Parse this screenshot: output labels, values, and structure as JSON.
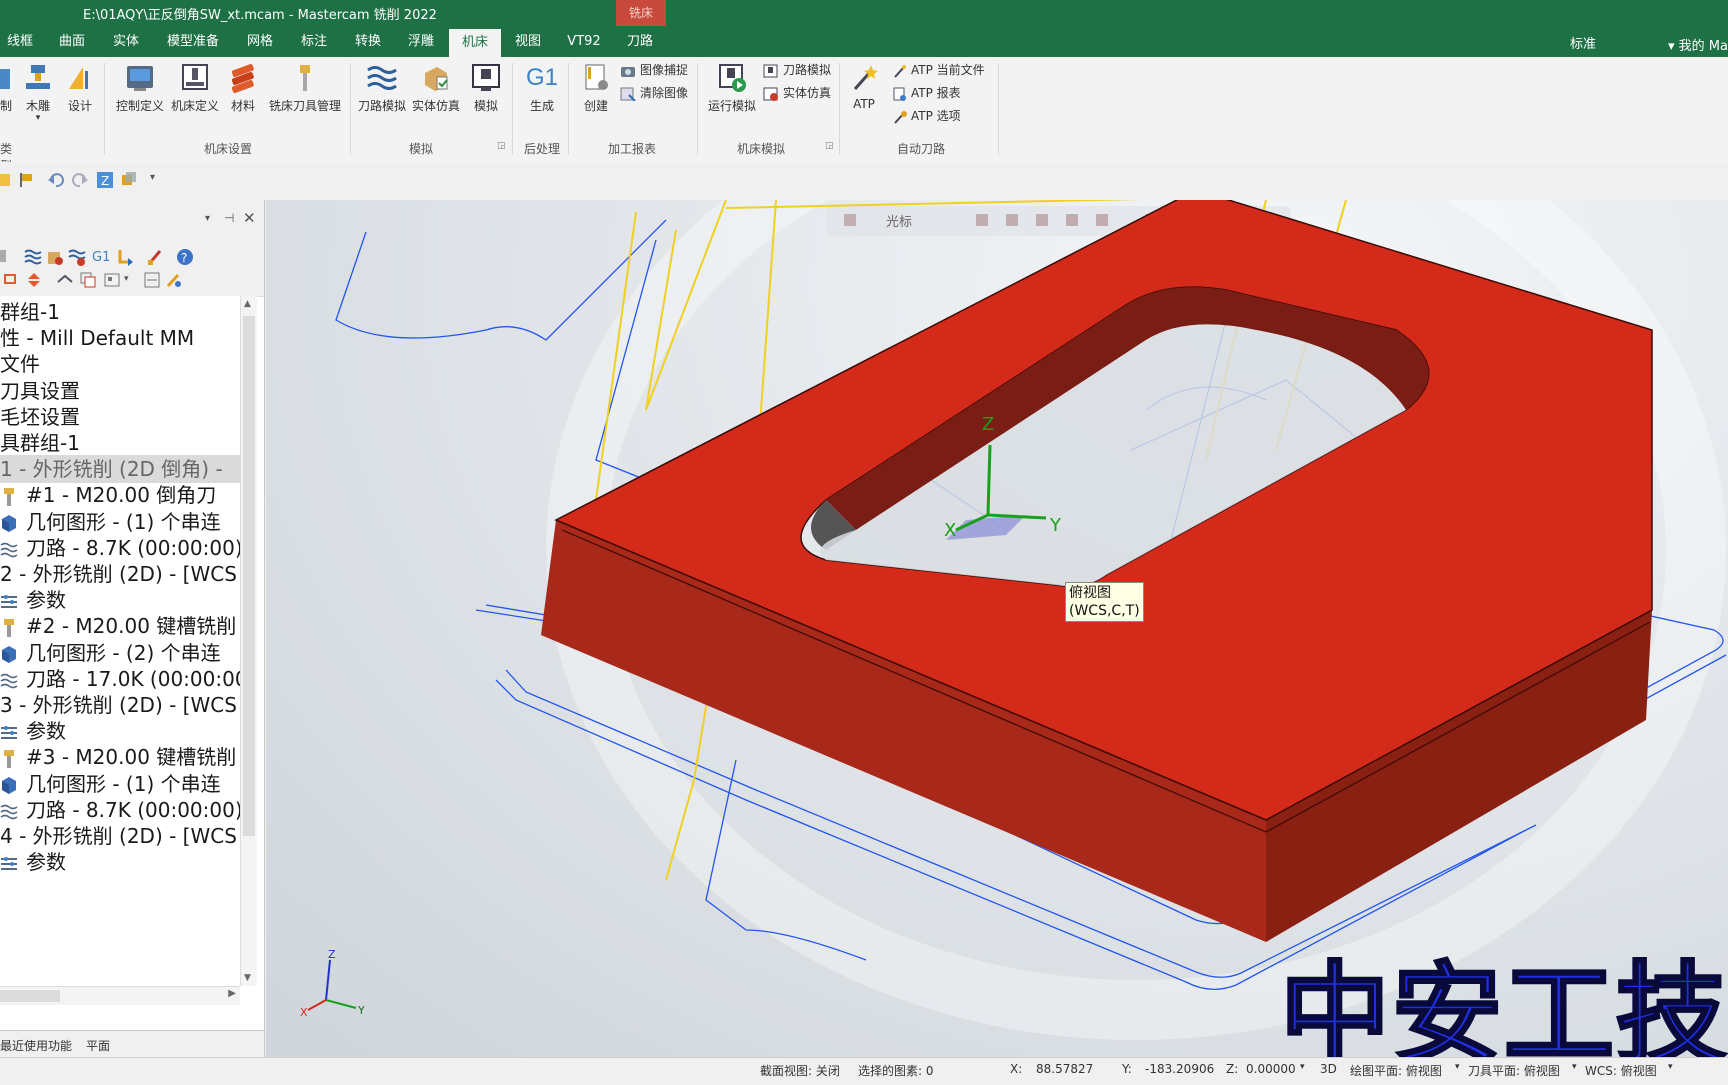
{
  "window": {
    "title": "E:\\01AQY\\正反倒角SW_xt.mcam - Mastercam 铣削 2022",
    "context_tab": "铣床"
  },
  "ribbon_tabs": [
    "线框",
    "曲面",
    "实体",
    "模型准备",
    "网格",
    "标注",
    "转换",
    "浮雕",
    "机床",
    "视图",
    "VT92",
    "刀路"
  ],
  "active_tab": "机床",
  "right": {
    "workspace": "标准",
    "account": "我的 Ma"
  },
  "ribbon": {
    "group_type": {
      "label": "类型",
      "btn1": "制",
      "btn2": "木雕",
      "btn3": "设计"
    },
    "group_machine": {
      "label": "机床设置",
      "btn1": "控制定义",
      "btn2": "机床定义",
      "btn3": "材料",
      "btn4": "铣床刀具管理"
    },
    "group_sim": {
      "label": "模拟",
      "btn1": "刀路模拟",
      "btn2": "实体仿真",
      "btn3": "模拟"
    },
    "group_post": {
      "label": "后处理",
      "btn1": "生成",
      "btn1_icon_text": "G1"
    },
    "group_report": {
      "label": "加工报表",
      "btn1": "创建",
      "small1": "图像捕捉",
      "small2": "清除图像"
    },
    "group_msim": {
      "label": "机床模拟",
      "btn1": "运行模拟",
      "small1": "刀路模拟",
      "small2": "实体仿真"
    },
    "group_atp": {
      "label": "自动刀路",
      "btn1": "ATP",
      "small1": "ATP 当前文件",
      "small2": "ATP 报表",
      "small3": "ATP 选项"
    }
  },
  "tree": [
    {
      "text": "群组-1",
      "indent": 0,
      "icon": "none"
    },
    {
      "text": "性 - Mill Default MM",
      "indent": 0,
      "icon": "none"
    },
    {
      "text": "文件",
      "indent": 0,
      "icon": "none"
    },
    {
      "text": "刀具设置",
      "indent": 0,
      "icon": "none"
    },
    {
      "text": "毛坯设置",
      "indent": 0,
      "icon": "none"
    },
    {
      "text": "具群组-1",
      "indent": 0,
      "icon": "none"
    },
    {
      "text": "1 - 外形铣削 (2D 倒角) -",
      "indent": 0,
      "icon": "none",
      "selected": true
    },
    {
      "text": "#1 - M20.00 倒角刀",
      "indent": 1,
      "icon": "tool"
    },
    {
      "text": "几何图形 - (1) 个串连",
      "indent": 1,
      "icon": "geometry"
    },
    {
      "text": "刀路 - 8.7K (00:00:00)",
      "indent": 1,
      "icon": "toolpath"
    },
    {
      "text": "2 - 外形铣削 (2D) - [WCS",
      "indent": 0,
      "icon": "none"
    },
    {
      "text": "参数",
      "indent": 1,
      "icon": "params"
    },
    {
      "text": "#2 - M20.00 键槽铣削",
      "indent": 1,
      "icon": "tool"
    },
    {
      "text": "几何图形 - (2) 个串连",
      "indent": 1,
      "icon": "geometry"
    },
    {
      "text": "刀路 - 17.0K (00:00:00",
      "indent": 1,
      "icon": "toolpath"
    },
    {
      "text": "3 - 外形铣削 (2D) - [WCS",
      "indent": 0,
      "icon": "none"
    },
    {
      "text": "参数",
      "indent": 1,
      "icon": "params"
    },
    {
      "text": "#3 - M20.00 键槽铣削",
      "indent": 1,
      "icon": "tool"
    },
    {
      "text": "几何图形 - (1) 个串连",
      "indent": 1,
      "icon": "geometry"
    },
    {
      "text": "刀路 - 8.7K (00:00:00)",
      "indent": 1,
      "icon": "toolpath"
    },
    {
      "text": "4 - 外形铣削 (2D) - [WCS",
      "indent": 0,
      "icon": "none"
    },
    {
      "text": "参数",
      "indent": 1,
      "icon": "params"
    }
  ],
  "panel_bottom": {
    "tab1": "最近使用功能",
    "tab2": "平面"
  },
  "viewport": {
    "toolbar_label": "光标",
    "gnomon": {
      "x": "X",
      "y": "Y",
      "z": "Z"
    },
    "tooltip_line1": "俯视图",
    "tooltip_line2": "(WCS,C,T)",
    "watermark": "中安工技"
  },
  "status": {
    "section_view": "截面视图: 关闭",
    "selected": "选择的图素: 0",
    "x_label": "X:",
    "x_value": "88.57827",
    "y_label": "Y:",
    "y_value": "-183.20906",
    "z_label": "Z:",
    "z_value": "0.00000",
    "mode": "3D",
    "draw_plane": "绘图平面: 俯视图",
    "tool_plane": "刀具平面: 俯视图",
    "wcs": "WCS: 俯视图"
  },
  "colors": {
    "title_green": "#1e7145",
    "part_red": "#d42a1a",
    "toolpath_blue": "#2255ee",
    "toolpath_yellow": "#f0d020"
  }
}
